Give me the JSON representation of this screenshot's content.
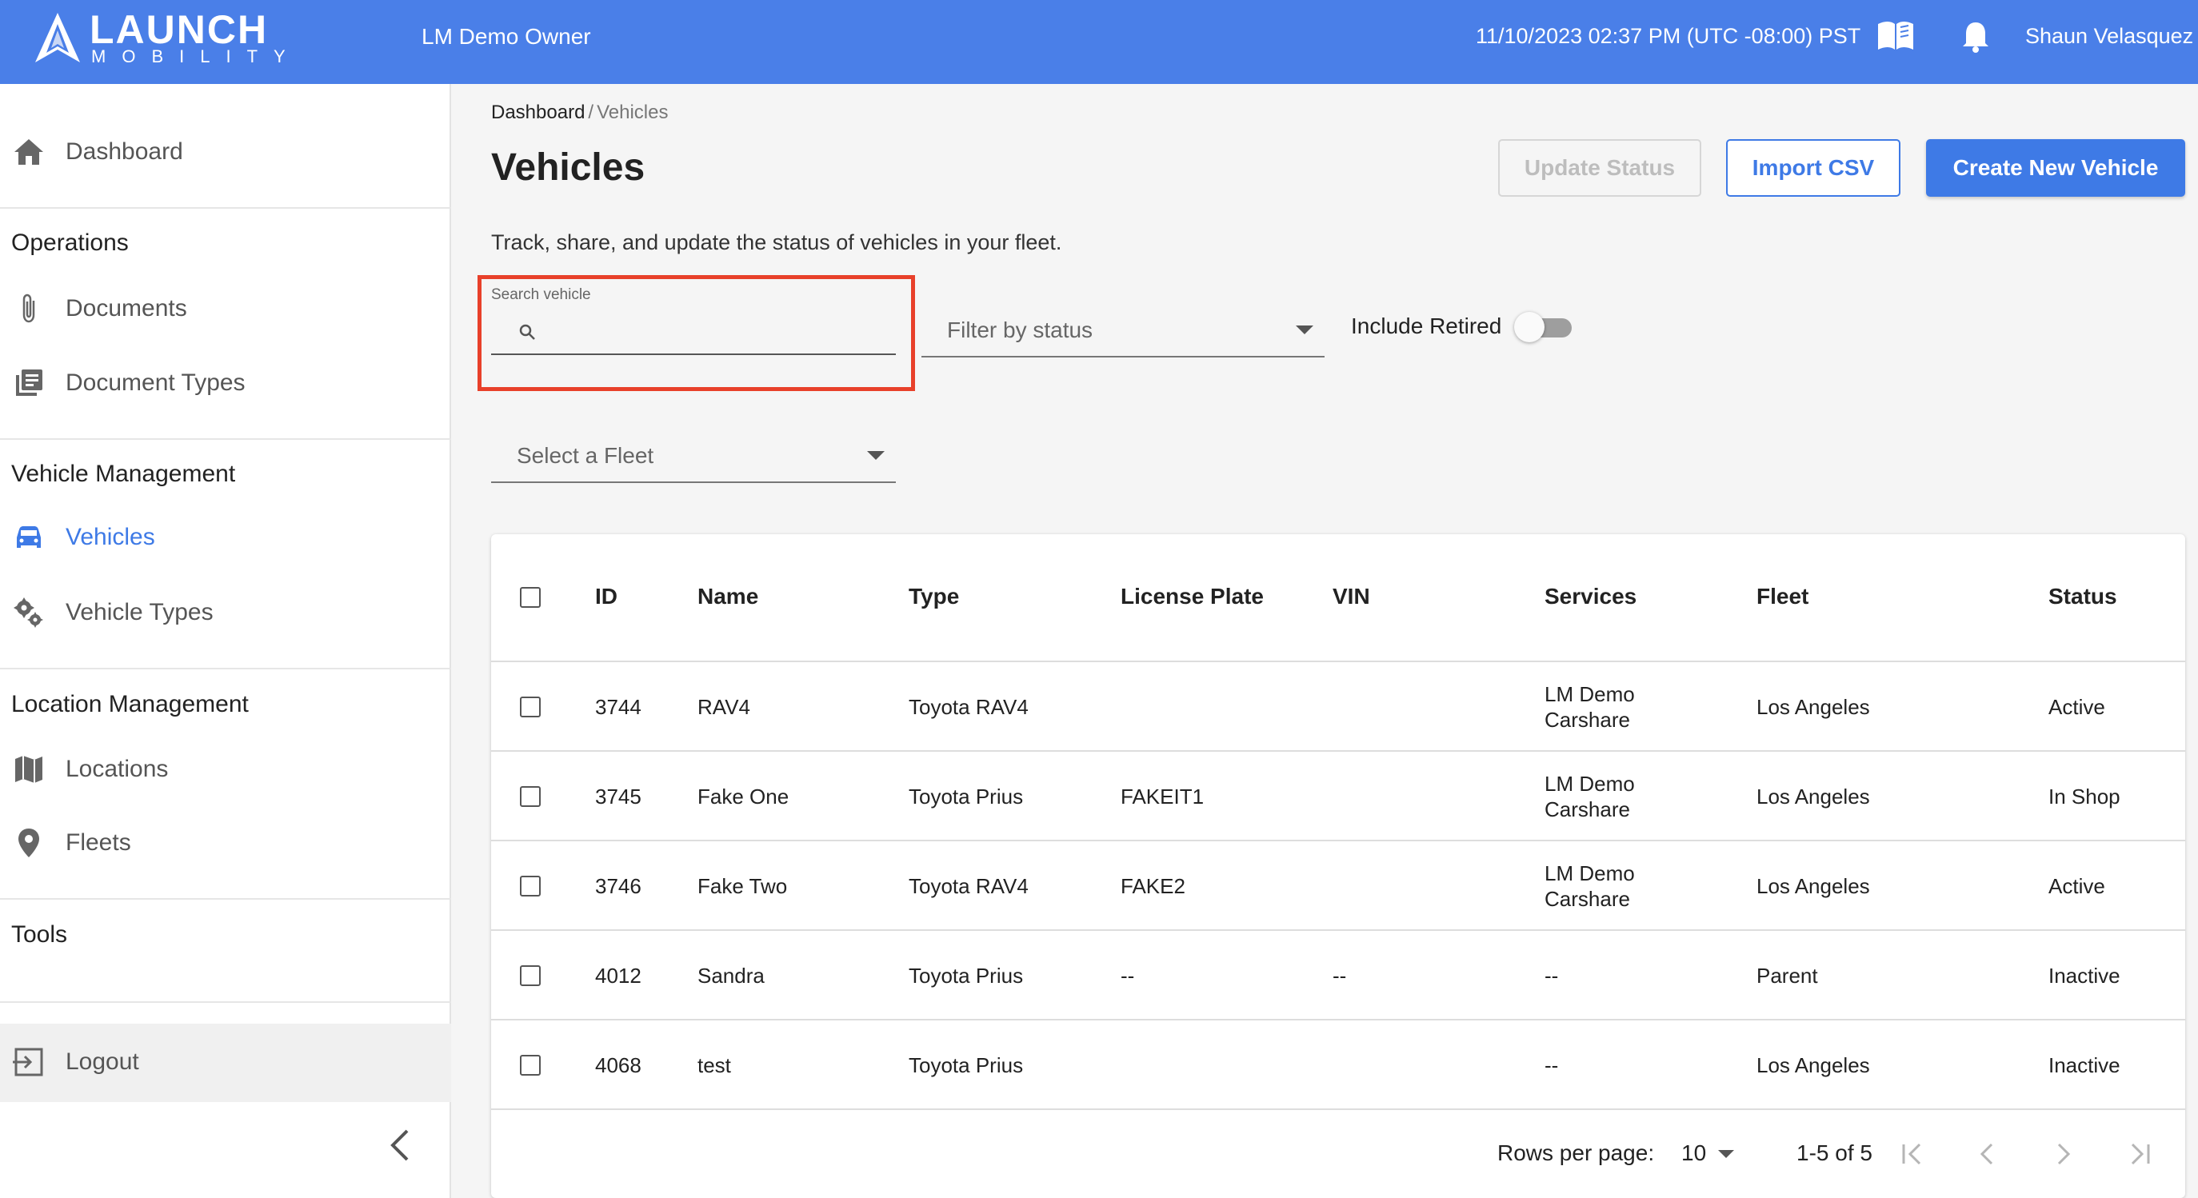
{
  "header": {
    "logo_main": "LAUNCH",
    "logo_sub": "MOBILITY",
    "org": "LM Demo Owner",
    "datetime": "11/10/2023 02:37 PM (UTC -08:00) PST",
    "user": "Shaun Velasquez",
    "icons": [
      "book-icon",
      "bell-icon"
    ],
    "color": "#4a7fe8"
  },
  "sidebar": {
    "dashboard": "Dashboard",
    "operations": {
      "heading": "Operations",
      "items": [
        "Documents",
        "Document Types"
      ]
    },
    "vehicle_management": {
      "heading": "Vehicle Management",
      "items": [
        "Vehicles",
        "Vehicle Types"
      ],
      "active": "Vehicles"
    },
    "location_management": {
      "heading": "Location Management",
      "items": [
        "Locations",
        "Fleets"
      ]
    },
    "tools": {
      "heading": "Tools"
    },
    "logout": "Logout"
  },
  "main": {
    "breadcrumb": [
      "Dashboard",
      "/",
      "Vehicles"
    ],
    "title": "Vehicles",
    "subtitle": "Track, share, and update the status of vehicles in your fleet.",
    "buttons": {
      "update_status": "Update Status",
      "import_csv": "Import CSV",
      "create_vehicle": "Create New Vehicle"
    },
    "search": {
      "label": "Search vehicle",
      "value": ""
    },
    "filter_status": {
      "placeholder": "Filter by status"
    },
    "include_retired": {
      "label": "Include Retired",
      "on": false
    },
    "fleet_select": {
      "placeholder": "Select a Fleet"
    },
    "accent_color": "#3e7ae6"
  },
  "table": {
    "columns": [
      "ID",
      "Name",
      "Type",
      "License Plate",
      "VIN",
      "Services",
      "Fleet",
      "Status"
    ],
    "rows": [
      {
        "id": "3744",
        "name": "RAV4",
        "type": "Toyota RAV4",
        "plate": "",
        "vin": "",
        "services_1": "LM Demo",
        "services_2": "Carshare",
        "fleet": "Los Angeles",
        "status": "Active"
      },
      {
        "id": "3745",
        "name": "Fake One",
        "type": "Toyota Prius",
        "plate": "FAKEIT1",
        "vin": "",
        "services_1": "LM Demo",
        "services_2": "Carshare",
        "fleet": "Los Angeles",
        "status": "In Shop"
      },
      {
        "id": "3746",
        "name": "Fake Two",
        "type": "Toyota RAV4",
        "plate": "FAKE2",
        "vin": "",
        "services_1": "LM Demo",
        "services_2": "Carshare",
        "fleet": "Los Angeles",
        "status": "Active"
      },
      {
        "id": "4012",
        "name": "Sandra",
        "type": "Toyota Prius",
        "plate": "--",
        "vin": "--",
        "services_1": "--",
        "services_2": "",
        "fleet": "Parent",
        "status": "Inactive"
      },
      {
        "id": "4068",
        "name": "test",
        "type": "Toyota Prius",
        "plate": "",
        "vin": "",
        "services_1": "--",
        "services_2": "",
        "fleet": "Los Angeles",
        "status": "Inactive"
      }
    ],
    "pagination": {
      "rows_per_page_label": "Rows per page:",
      "rows_per_page": "10",
      "range": "1-5 of 5"
    }
  }
}
